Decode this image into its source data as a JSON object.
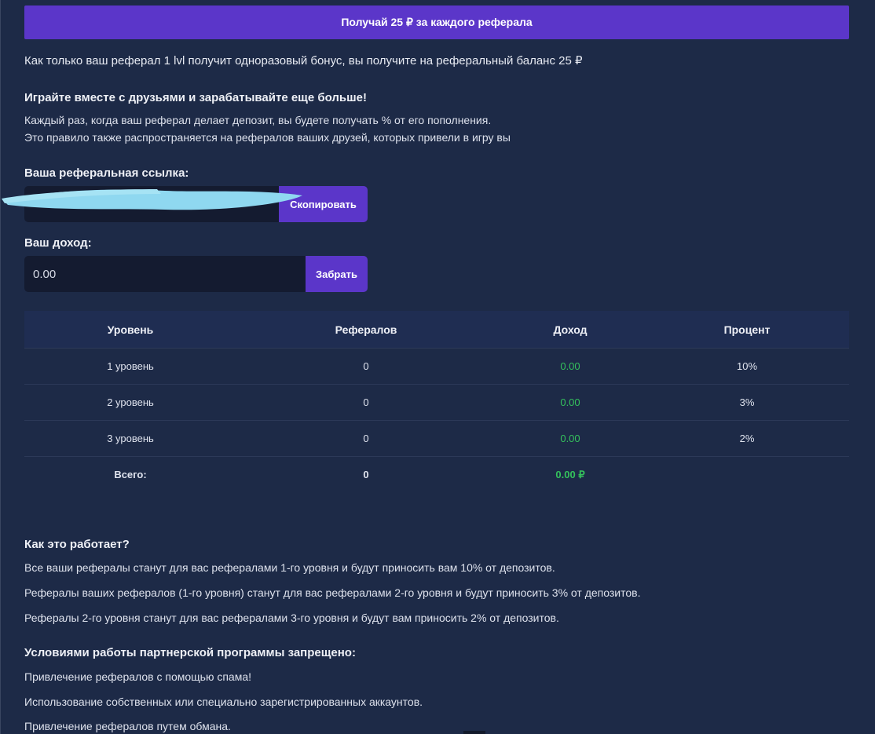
{
  "banner": {
    "label": "Получай 25 ₽ за каждого реферала"
  },
  "intro_text": "Как только ваш реферал 1 lvl получит одноразовый бонус, вы получите на реферальный баланс 25 ₽",
  "play_together": {
    "title": "Играйте вместе с друзьями и зарабатывайте еще больше!",
    "line1": "Каждый раз, когда ваш реферал делает депозит, вы будете получать % от его пополнения.",
    "line2": "Это правило также распространяется на рефералов ваших друзей, которых привели в игру вы"
  },
  "referral_link": {
    "label": "Ваша реферальная ссылка:",
    "copy_button": "Скопировать"
  },
  "income": {
    "label": "Ваш доход:",
    "value": "0.00",
    "claim_button": "Забрать"
  },
  "levels_table": {
    "headers": [
      "Уровень",
      "Рефералов",
      "Доход",
      "Процент"
    ],
    "rows": [
      {
        "level": "1 уровень",
        "referrals": "0",
        "income": "0.00",
        "percent": "10%"
      },
      {
        "level": "2 уровень",
        "referrals": "0",
        "income": "0.00",
        "percent": "3%"
      },
      {
        "level": "3 уровень",
        "referrals": "0",
        "income": "0.00",
        "percent": "2%"
      }
    ],
    "total": {
      "label": "Всего:",
      "referrals": "0",
      "income": "0.00 ₽"
    }
  },
  "how_it_works": {
    "title": "Как это работает?",
    "line1": "Все ваши рефералы станут для вас рефералами 1-го уровня и будут приносить вам 10% от депозитов.",
    "line2": "Рефералы ваших рефералов (1-го уровня) станут для вас рефералами 2-го уровня и будут приносить 3% от депозитов.",
    "line3": "Рефералы 2-го уровня станут для вас рефералами 3-го уровня и будут вам приносить 2% от депозитов."
  },
  "forbidden": {
    "title": "Условиями работы партнерской программы запрещено:",
    "line1": "Привлечение рефералов с помощью спама!",
    "line2": "Использование собственных или специально зарегистрированных аккаунтов.",
    "line3": "Привлечение рефералов путем обмана."
  },
  "colors": {
    "accent": "#5b36c9",
    "background": "#1d2a47",
    "positive": "#34c15c",
    "redaction": "#8fd8f0"
  }
}
